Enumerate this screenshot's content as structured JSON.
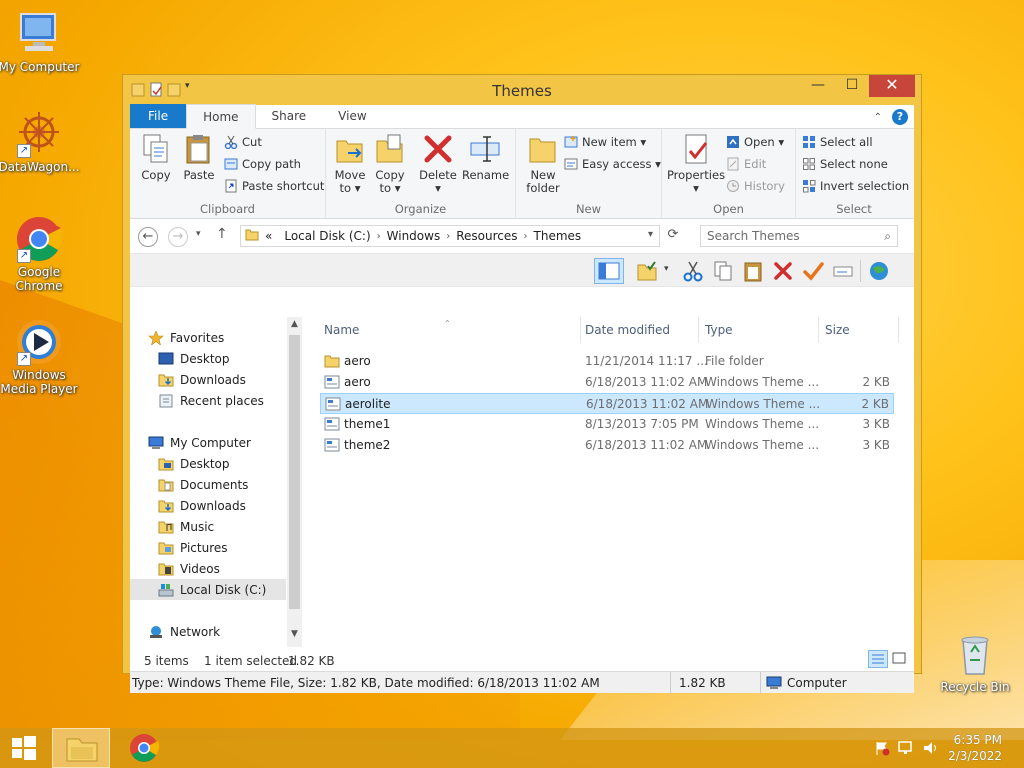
{
  "desktop": {
    "icons": [
      {
        "label": "My Computer"
      },
      {
        "label": "DataWagon..."
      },
      {
        "label": "Google Chrome"
      },
      {
        "label": "Windows Media Player"
      },
      {
        "label": "Recycle Bin"
      }
    ]
  },
  "window": {
    "title": "Themes",
    "controls": {
      "minimize": "—",
      "maximize": "☐",
      "close": "✕"
    }
  },
  "ribbon": {
    "tabs": [
      "File",
      "Home",
      "Share",
      "View"
    ],
    "clipboard": {
      "label": "Clipboard",
      "copy": "Copy",
      "paste": "Paste",
      "cut": "Cut",
      "copy_path": "Copy path",
      "paste_shortcut": "Paste shortcut"
    },
    "organize": {
      "label": "Organize",
      "move_to": "Move to ▾",
      "copy_to": "Copy to ▾",
      "delete": "Delete",
      "rename": "Rename",
      "move_to_l1": "Move",
      "move_to_l2": "to ▾",
      "copy_to_l1": "Copy",
      "copy_to_l2": "to ▾",
      "delete_arrow": "▾"
    },
    "new": {
      "label": "New",
      "new_folder_l1": "New",
      "new_folder_l2": "folder",
      "new_item": "New item ▾",
      "easy_access": "Easy access ▾"
    },
    "open": {
      "label": "Open",
      "properties": "Properties",
      "properties_arrow": "▾",
      "open": "Open ▾",
      "edit": "Edit",
      "history": "History"
    },
    "select": {
      "label": "Select",
      "select_all": "Select all",
      "select_none": "Select none",
      "invert": "Invert selection"
    }
  },
  "address": {
    "prefix": "«",
    "crumbs": [
      "Local Disk (C:)",
      "Windows",
      "Resources",
      "Themes"
    ],
    "search_placeholder": "Search Themes"
  },
  "nav": {
    "favorites": "Favorites",
    "fav_items": [
      "Desktop",
      "Downloads",
      "Recent places"
    ],
    "computer": "My Computer",
    "computer_items": [
      "Desktop",
      "Documents",
      "Downloads",
      "Music",
      "Pictures",
      "Videos",
      "Local Disk (C:)"
    ],
    "network": "Network"
  },
  "columns": {
    "name": "Name",
    "date": "Date modified",
    "type": "Type",
    "size": "Size"
  },
  "files": [
    {
      "name": "aero",
      "date": "11/21/2014 11:17 ...",
      "type": "File folder",
      "size": ""
    },
    {
      "name": "aero",
      "date": "6/18/2013 11:02 AM",
      "type": "Windows Theme ...",
      "size": "2 KB"
    },
    {
      "name": "aerolite",
      "date": "6/18/2013 11:02 AM",
      "type": "Windows Theme ...",
      "size": "2 KB"
    },
    {
      "name": "theme1",
      "date": "8/13/2013 7:05 PM",
      "type": "Windows Theme ...",
      "size": "3 KB"
    },
    {
      "name": "theme2",
      "date": "6/18/2013 11:02 AM",
      "type": "Windows Theme ...",
      "size": "3 KB"
    }
  ],
  "status": {
    "count": "5 items",
    "selected": "1 item selected",
    "selsize": "1.82 KB"
  },
  "details": {
    "text": "Type: Windows Theme File, Size: 1.82 KB, Date modified: 6/18/2013 11:02 AM",
    "size": "1.82 KB",
    "location": "Computer"
  },
  "taskbar": {
    "time": "6:35 PM",
    "date": "2/3/2022"
  }
}
